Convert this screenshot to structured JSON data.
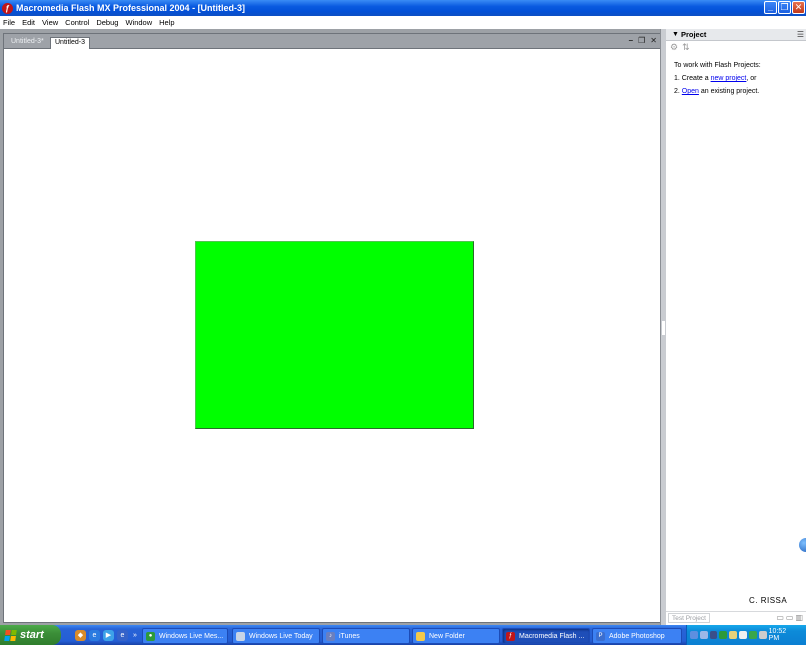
{
  "window": {
    "title": "Macromedia Flash MX Professional 2004 - [Untitled-3]",
    "icon": "flash-app-icon"
  },
  "menu": [
    "File",
    "Edit",
    "View",
    "Control",
    "Debug",
    "Window",
    "Help"
  ],
  "document": {
    "tabs": [
      {
        "label": "Untitled-3*",
        "active": false
      },
      {
        "label": "Untitled-3",
        "active": true
      }
    ],
    "stage_shape_color": "#00ff00"
  },
  "project_panel": {
    "title": "Project",
    "intro": "To work with Flash Projects:",
    "step1_prefix": "1. Create a ",
    "step1_link": "new project",
    "step1_suffix": ", or",
    "step2_prefix": "2. ",
    "step2_link": "Open",
    "step2_suffix": " an existing project.",
    "test_button": "Test Project"
  },
  "watermark": "C. RISSA",
  "taskbar": {
    "start_label": "start",
    "tasks": [
      {
        "label": "Windows Live Mes...",
        "icon": "messenger-icon",
        "color": "#2d9a3a"
      },
      {
        "label": "Windows Live Today",
        "icon": "window-icon",
        "color": "#c8d4e6"
      },
      {
        "label": "iTunes",
        "icon": "itunes-icon",
        "color": "#6a7fbf"
      },
      {
        "label": "New Folder",
        "icon": "folder-icon",
        "color": "#f3c94a"
      },
      {
        "label": "Macromedia Flash ...",
        "icon": "flash-icon",
        "color": "#c0161a",
        "active": true
      },
      {
        "label": "Adobe Photoshop",
        "icon": "photoshop-icon",
        "color": "#3a6ed0"
      }
    ],
    "clock": "10:52 PM"
  }
}
